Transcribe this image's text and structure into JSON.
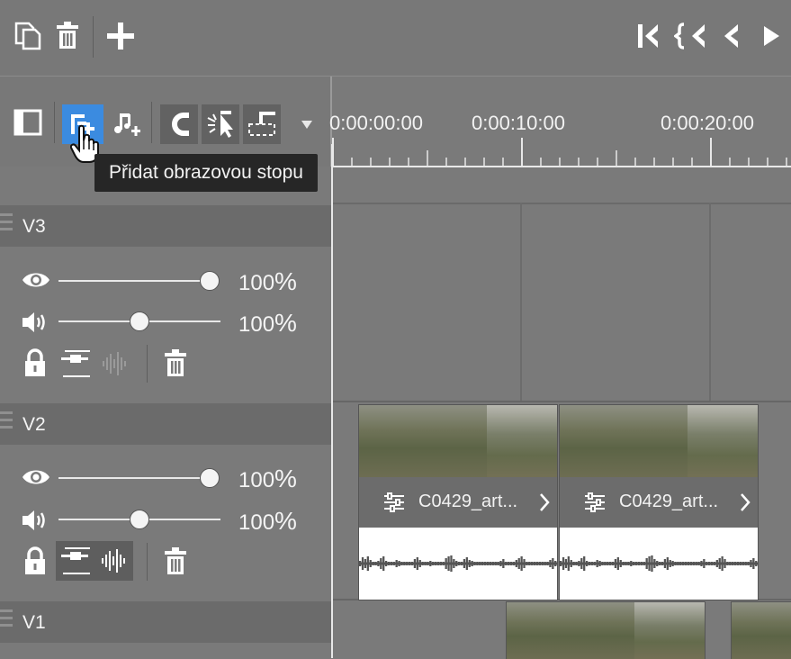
{
  "top_toolbar": {
    "copy_icon": "copy-icon",
    "delete_icon": "trash-icon",
    "add_icon": "plus-icon",
    "nav_icons": [
      "skip-to-start-icon",
      "prev-marker-icon",
      "prev-frame-icon",
      "play-icon"
    ]
  },
  "track_toolbar": {
    "icons": [
      "panel-toggle-icon",
      "add-video-track-icon",
      "add-audio-track-icon",
      "magnet-icon",
      "select-cursor-icon",
      "ripple-icon",
      "dropdown-arrow-icon"
    ]
  },
  "tooltip": "Přidat obrazovou stopu",
  "ruler": {
    "timecodes": [
      "0:00:00:00",
      "0:00:10:00",
      "0:00:20:00"
    ]
  },
  "tracks": [
    {
      "name": "V3",
      "opacity_value": "100",
      "volume_value": "100",
      "unit": "%",
      "opacity_level": 1.0,
      "volume_level": 0.5
    },
    {
      "name": "V2",
      "opacity_value": "100",
      "volume_value": "100",
      "unit": "%",
      "opacity_level": 1.0,
      "volume_level": 0.5
    },
    {
      "name": "V1"
    }
  ],
  "clips": [
    {
      "label": "C0429_art..."
    },
    {
      "label": "C0429_art..."
    }
  ],
  "colors": {
    "background": "#7a7a7a",
    "track_header": "#6b6b6b",
    "active_button": "#3b8be0",
    "tooltip_bg": "#262626"
  }
}
